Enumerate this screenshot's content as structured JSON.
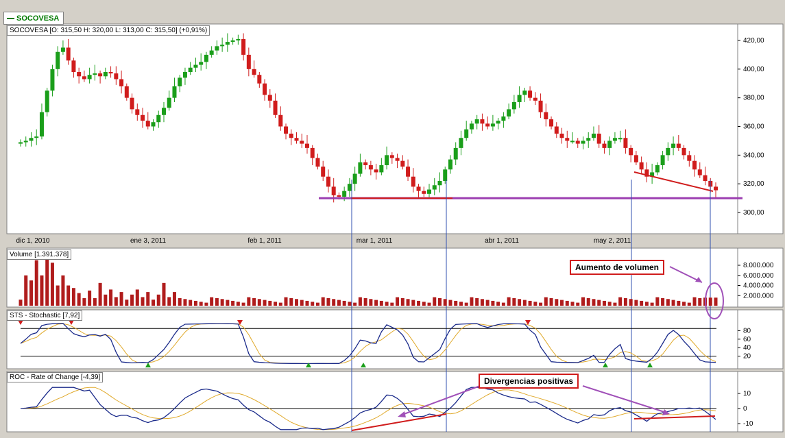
{
  "window": {
    "symbol_legend": "SOCOVESA"
  },
  "colors": {
    "up": "#1a9e1a",
    "down": "#d01c1c",
    "volume": "#b01c1c",
    "line_main": "#1a2a8a",
    "line_signal": "#e0a92a",
    "support": "#9b3db0",
    "annotation": "#d01c1c",
    "arrow": "#a050b8",
    "marker_top": "#d01c1c",
    "marker_bottom": "#1a9e1a",
    "guide": "#3050b0"
  },
  "panels": {
    "price": {
      "label": "SOCOVESA [O: 315,50  H: 320,00  L: 313,00  C: 315,50] (+0,91%)"
    },
    "volume": {
      "label": "Volume [1.391.378]"
    },
    "stochastic": {
      "label": "STS - Stochastic [7,92]"
    },
    "roc": {
      "label": "ROC - Rate of Change [-4,39]"
    }
  },
  "annotations": {
    "volume_callout": "Aumento de volumen",
    "divergence_callout": "Divergencias positivas"
  },
  "chart_data": [
    {
      "type": "candlestick",
      "title": "SOCOVESA",
      "x_tick_labels": [
        "dic 1, 2010",
        "ene 3, 2011",
        "feb 1, 2011",
        "mar 1, 2011",
        "abr 1, 2011",
        "may 2, 2011"
      ],
      "y_tick_labels": [
        "420,00",
        "400,00",
        "380,00",
        "360,00",
        "340,00",
        "320,00",
        "300,00"
      ],
      "ylim": [
        290,
        425
      ],
      "support_level": 310,
      "last_bar": {
        "open": 315.5,
        "high": 320.0,
        "low": 313.0,
        "close": 315.5,
        "change_pct": 0.91
      },
      "closes": [
        349,
        350,
        352,
        353,
        370,
        385,
        400,
        412,
        415,
        406,
        398,
        395,
        393,
        396,
        397,
        395,
        398,
        397,
        393,
        388,
        380,
        372,
        368,
        364,
        360,
        363,
        368,
        373,
        380,
        388,
        394,
        398,
        401,
        403,
        405,
        410,
        413,
        416,
        417,
        419,
        420,
        421,
        410,
        400,
        396,
        390,
        382,
        378,
        368,
        360,
        355,
        352,
        350,
        348,
        345,
        338,
        332,
        325,
        318,
        312,
        311,
        315,
        320,
        327,
        335,
        333,
        330,
        328,
        333,
        340,
        338,
        336,
        332,
        325,
        318,
        315,
        313,
        316,
        319,
        322,
        330,
        337,
        345,
        352,
        358,
        362,
        365,
        362,
        360,
        362,
        364,
        367,
        372,
        377,
        382,
        385,
        380,
        378,
        370,
        365,
        360,
        355,
        352,
        350,
        350,
        348,
        350,
        352,
        355,
        348,
        345,
        350,
        352,
        352,
        345,
        340,
        335,
        330,
        325,
        328,
        333,
        340,
        345,
        348,
        345,
        340,
        336,
        330,
        326,
        322,
        318,
        315.5
      ],
      "volume_y_tick_labels": [
        "8.000.000",
        "6.000.000",
        "4.000.000",
        "2.000.000"
      ],
      "volume_last": 1391378,
      "stochastic_y_tick_labels": [
        "80",
        "60",
        "40",
        "20"
      ],
      "stochastic_last": 7.92,
      "roc_y_tick_labels": [
        "10",
        "0",
        "-10"
      ],
      "roc_last": -4.39
    }
  ]
}
